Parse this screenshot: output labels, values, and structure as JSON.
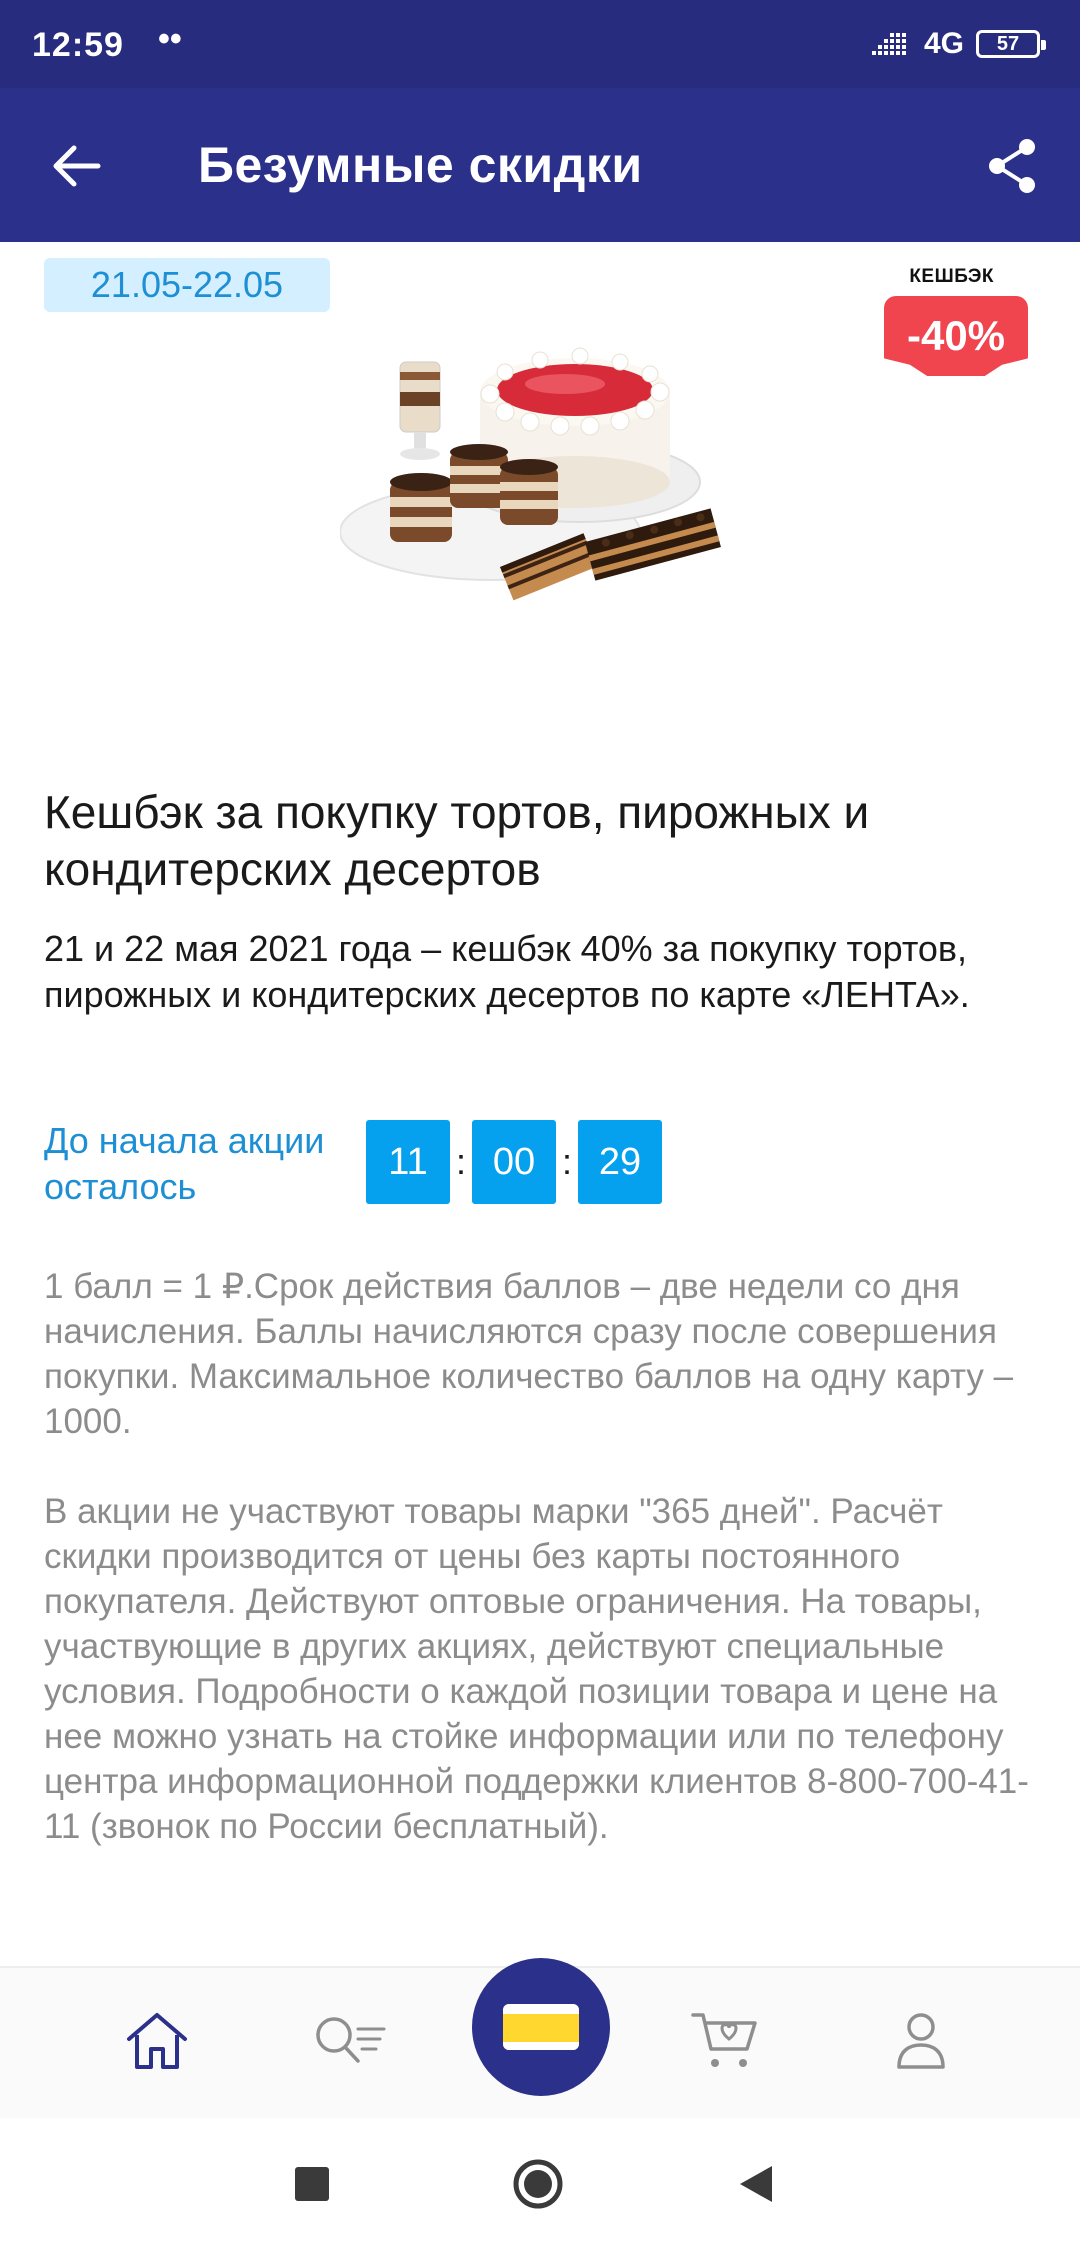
{
  "status_bar": {
    "time": "12:59",
    "dots": "••",
    "network": "4G",
    "battery": "57"
  },
  "app_bar": {
    "title": "Безумные скидки"
  },
  "promo": {
    "date_range": "21.05-22.05",
    "cashback_label": "КЕШБЭК",
    "cashback_value": "-40%",
    "title": "Кешбэк за покупку тортов, пирожных и кондитерских десертов",
    "description": "21 и 22 мая 2021 года – кешбэк 40% за покупку тортов, пирожных и  кондитерских десертов по карте «ЛЕНТА».",
    "countdown_label": "До начала акции осталось",
    "countdown": {
      "hours": "11",
      "minutes": "00",
      "seconds": "29",
      "separator": ":"
    },
    "terms_1": "1 балл = 1 ₽.Срок действия баллов – две недели со дня начисления. Баллы начисляются сразу после совершения покупки. Максимальное количество баллов на одну карту – 1000.",
    "terms_2": "В акции не участвуют товары марки \"365 дней\". Расчёт скидки производится от цены без карты постоянного покупателя. Действуют оптовые ограничения. На товары, участвующие в других акциях, действуют специальные условия. Подробности о каждой позиции товара и цене на нее можно узнать на стойке информации или по телефону центра информационной поддержки клиентов 8-800-700-41-11 (звонок по России бесплатный)."
  },
  "bottom_nav": {
    "items": [
      "home-icon",
      "search-catalog-icon",
      "loyalty-card-icon",
      "cart-icon",
      "profile-icon"
    ]
  },
  "colors": {
    "app_bar": "#2b318a",
    "status_bar": "#272c7e",
    "accent_blue": "#05a0ee",
    "cashback_red": "#f0444e",
    "date_badge_bg": "#d4efff",
    "card_yellow": "#ffd72e"
  }
}
